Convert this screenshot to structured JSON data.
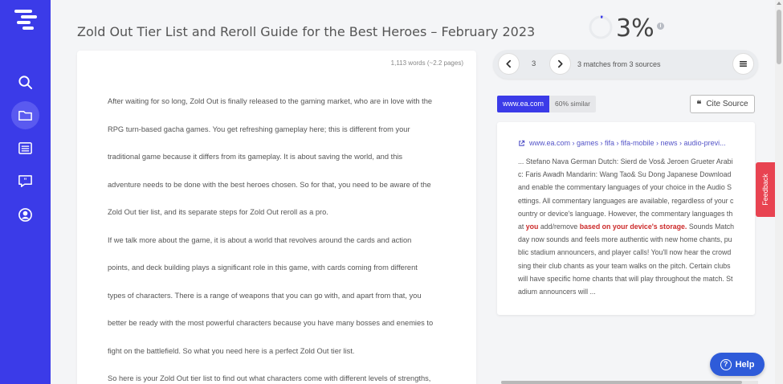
{
  "document": {
    "title": "Zold Out Tier List and Reroll Guide for the Best Heroes – February 2023",
    "word_count": "1,113 words (~2.2 pages)",
    "lines": [
      "After waiting for so long, Zold Out is finally released to the gaming market, who are in love with the",
      "RPG turn-based gacha games. You get refreshing gameplay here; this is different from your",
      "traditional game because it differs from its gameplay. It is about saving the world, and this",
      "adventure needs to be done with the best heroes chosen. So for that, you need to be aware of the",
      "Zold Out tier list, and its separate steps for Zold Out reroll as a pro.",
      "If we talk more about the game, it is about a world that revolves around the cards and action",
      "points, and deck building plays a significant role in this game, with cards coming from different",
      "types of characters. There is a range of weapons that you can go with, and apart from that, you",
      "better be ready with the most powerful characters because you have many bosses and enemies to",
      "fight on the battlefield. So what you need here is a perfect Zold Out tier list.",
      "So here is your Zold Out tier list to find out what characters come with different levels of strengths,"
    ]
  },
  "score": {
    "value": "3%",
    "percent": 3,
    "ring_color": "#e9ebee"
  },
  "matches": {
    "current": "3",
    "summary": "3 matches from 3 sources"
  },
  "source": {
    "domain": "www.ea.com",
    "similarity": "60% similar",
    "cite_label": "Cite Source",
    "url": "www.ea.com › games › fifa › fifa-mobile › news › audio-previ...",
    "excerpt_before": "... Stefano Nava German Dutch: Sierd de Vos& Jeroen Grueter Arabic: Faris Awadh Mandarin: Wang Tao& Su Dong Japanese Download and enable the commentary languages of your choice in the Audio Settings. All commentary languages are available, regardless of your country or device's language. However, the commentary languages that ",
    "excerpt_you": "you",
    "excerpt_mid": " add/remove ",
    "excerpt_highlight": "based on your device's storage.",
    "excerpt_after": " Sounds Matchday now sounds and feels more authentic with new home chants, public stadium announcers, and player calls! You'll now hear the crowd sing their club chants as your team walks on the pitch. Certain clubs will have specific home chants that will play throughout the match. Stadium announcers will ..."
  },
  "feedback_label": "Feedback",
  "help_label": "Help",
  "colors": {
    "sidebar": "#3b3be8",
    "accent": "#3b3be8",
    "highlight": "#cc2a2a",
    "feedback": "#e84351",
    "help": "#2e5bd9"
  },
  "icons": {
    "sidebar": [
      "logo-icon",
      "search-icon",
      "folder-icon",
      "list-icon",
      "quote-chat-icon",
      "user-icon"
    ]
  }
}
